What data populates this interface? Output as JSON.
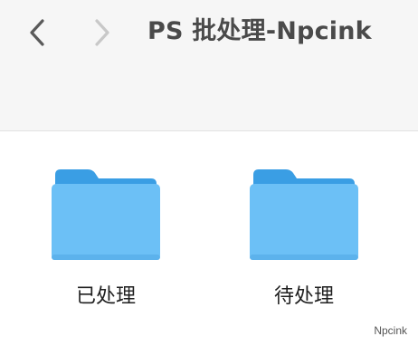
{
  "toolbar": {
    "title": "PS 批处理-Npcink",
    "back_icon": "chevron-left-icon",
    "forward_icon": "chevron-right-icon"
  },
  "folders": [
    {
      "label": "已处理",
      "icon": "folder-icon"
    },
    {
      "label": "待处理",
      "icon": "folder-icon"
    }
  ],
  "watermark": "Npcink",
  "colors": {
    "toolbar_bg": "#f6f6f6",
    "folder_back": "#3a9ee4",
    "folder_front": "#6cc0f6",
    "nav_active": "#5a5a5a",
    "nav_disabled": "#c8c8c8"
  }
}
